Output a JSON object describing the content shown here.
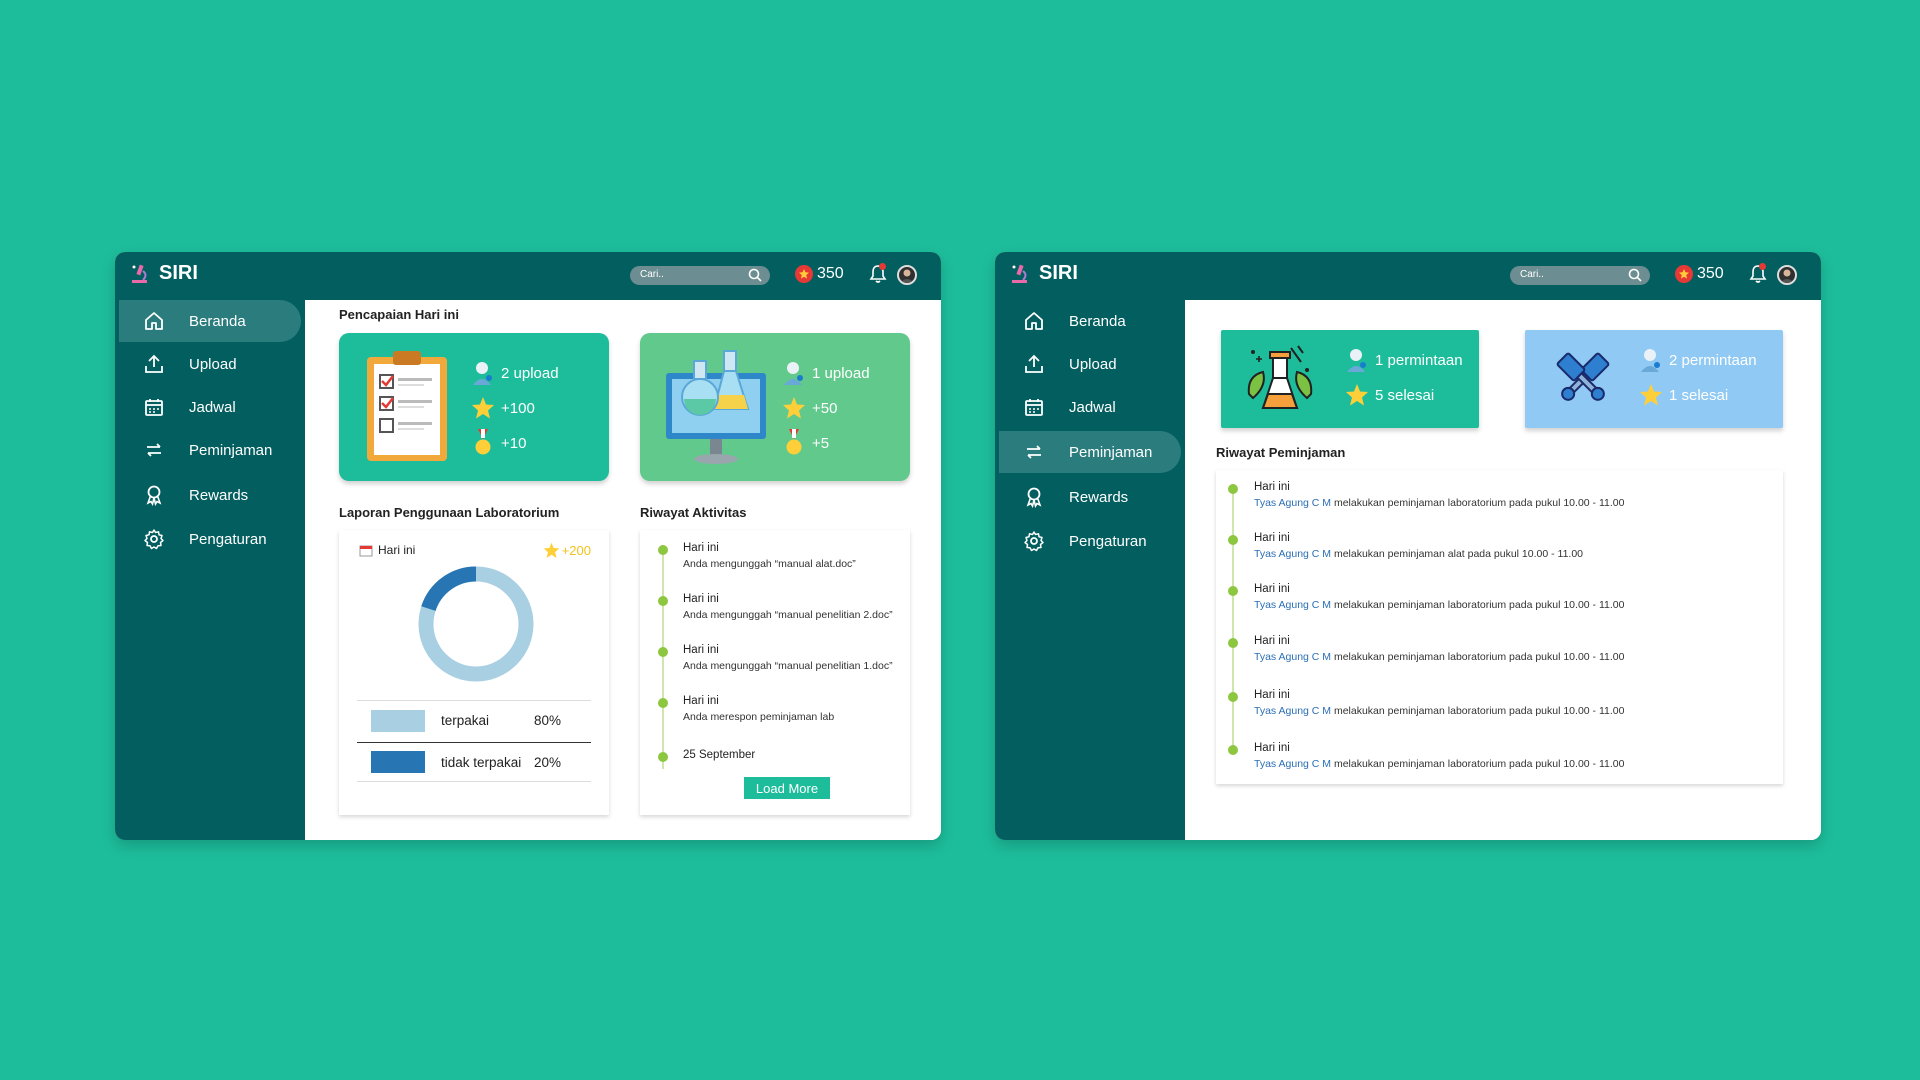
{
  "app": {
    "title": "SIRI"
  },
  "topbar": {
    "search_placeholder": "Cari..",
    "points": "350"
  },
  "nav": [
    {
      "label": "Beranda",
      "icon": "home-icon"
    },
    {
      "label": "Upload",
      "icon": "upload-icon"
    },
    {
      "label": "Jadwal",
      "icon": "calendar-icon"
    },
    {
      "label": "Peminjaman",
      "icon": "transfer-icon"
    },
    {
      "label": "Rewards",
      "icon": "award-icon"
    },
    {
      "label": "Pengaturan",
      "icon": "gear-icon"
    }
  ],
  "beranda": {
    "active_nav": "Beranda",
    "achievement_title": "Pencapaian Hari ini",
    "cards": [
      {
        "upload": "2 upload",
        "points": "+100",
        "medal": "+10",
        "color": "#1dbd9b",
        "icon": "clipboard-checklist-icon"
      },
      {
        "upload": "1 upload",
        "points": "+50",
        "medal": "+5",
        "color": "#62c98c",
        "icon": "lab-monitor-icon"
      }
    ],
    "report": {
      "title": "Laporan Penggunaan Laboratorium",
      "date_label": "Hari ini",
      "bonus": "+200",
      "legend": [
        {
          "label": "terpakai",
          "pct": "80%",
          "color": "#a9cfe2"
        },
        {
          "label": "tidak terpakai",
          "pct": "20%",
          "color": "#2776b3"
        }
      ]
    },
    "activity": {
      "title": "Riwayat Aktivitas",
      "items": [
        {
          "title": "Hari ini",
          "desc": "Anda mengunggah “manual alat.doc”"
        },
        {
          "title": "Hari ini",
          "desc": "Anda mengunggah “manual penelitian 2.doc”"
        },
        {
          "title": "Hari ini",
          "desc": "Anda mengunggah “manual penelitian 1.doc”"
        },
        {
          "title": "Hari ini",
          "desc": "Anda merespon peminjaman lab"
        },
        {
          "title": "25 September",
          "desc": ""
        }
      ],
      "load_more": "Load More"
    }
  },
  "peminjaman": {
    "active_nav": "Peminjaman",
    "cards": [
      {
        "requests": "1 permintaan",
        "done": "5 selesai",
        "color": "#1dbd9b",
        "icon": "lab-plants-icon"
      },
      {
        "requests": "2 permintaan",
        "done": "1 selesai",
        "color": "#8fc9f4",
        "icon": "crossed-pistons-icon"
      }
    ],
    "history": {
      "title": "Riwayat Peminjaman",
      "items": [
        {
          "title": "Hari ini",
          "user": "Tyas Agung C M",
          "desc": " melakukan peminjaman laboratorium pada pukul 10.00 - 11.00"
        },
        {
          "title": "Hari ini",
          "user": "Tyas Agung C M",
          "desc": " melakukan peminjaman alat pada pukul 10.00 - 11.00"
        },
        {
          "title": "Hari ini",
          "user": "Tyas Agung C M",
          "desc": " melakukan peminjaman laboratorium pada pukul 10.00 - 11.00"
        },
        {
          "title": "Hari ini",
          "user": "Tyas Agung C M",
          "desc": " melakukan peminjaman laboratorium pada pukul 10.00 - 11.00"
        },
        {
          "title": "Hari ini",
          "user": "Tyas Agung C M",
          "desc": " melakukan peminjaman laboratorium pada pukul 10.00 - 11.00"
        },
        {
          "title": "Hari ini",
          "user": "Tyas Agung C M",
          "desc": " melakukan peminjaman laboratorium pada pukul 10.00 - 11.00"
        }
      ]
    }
  }
}
